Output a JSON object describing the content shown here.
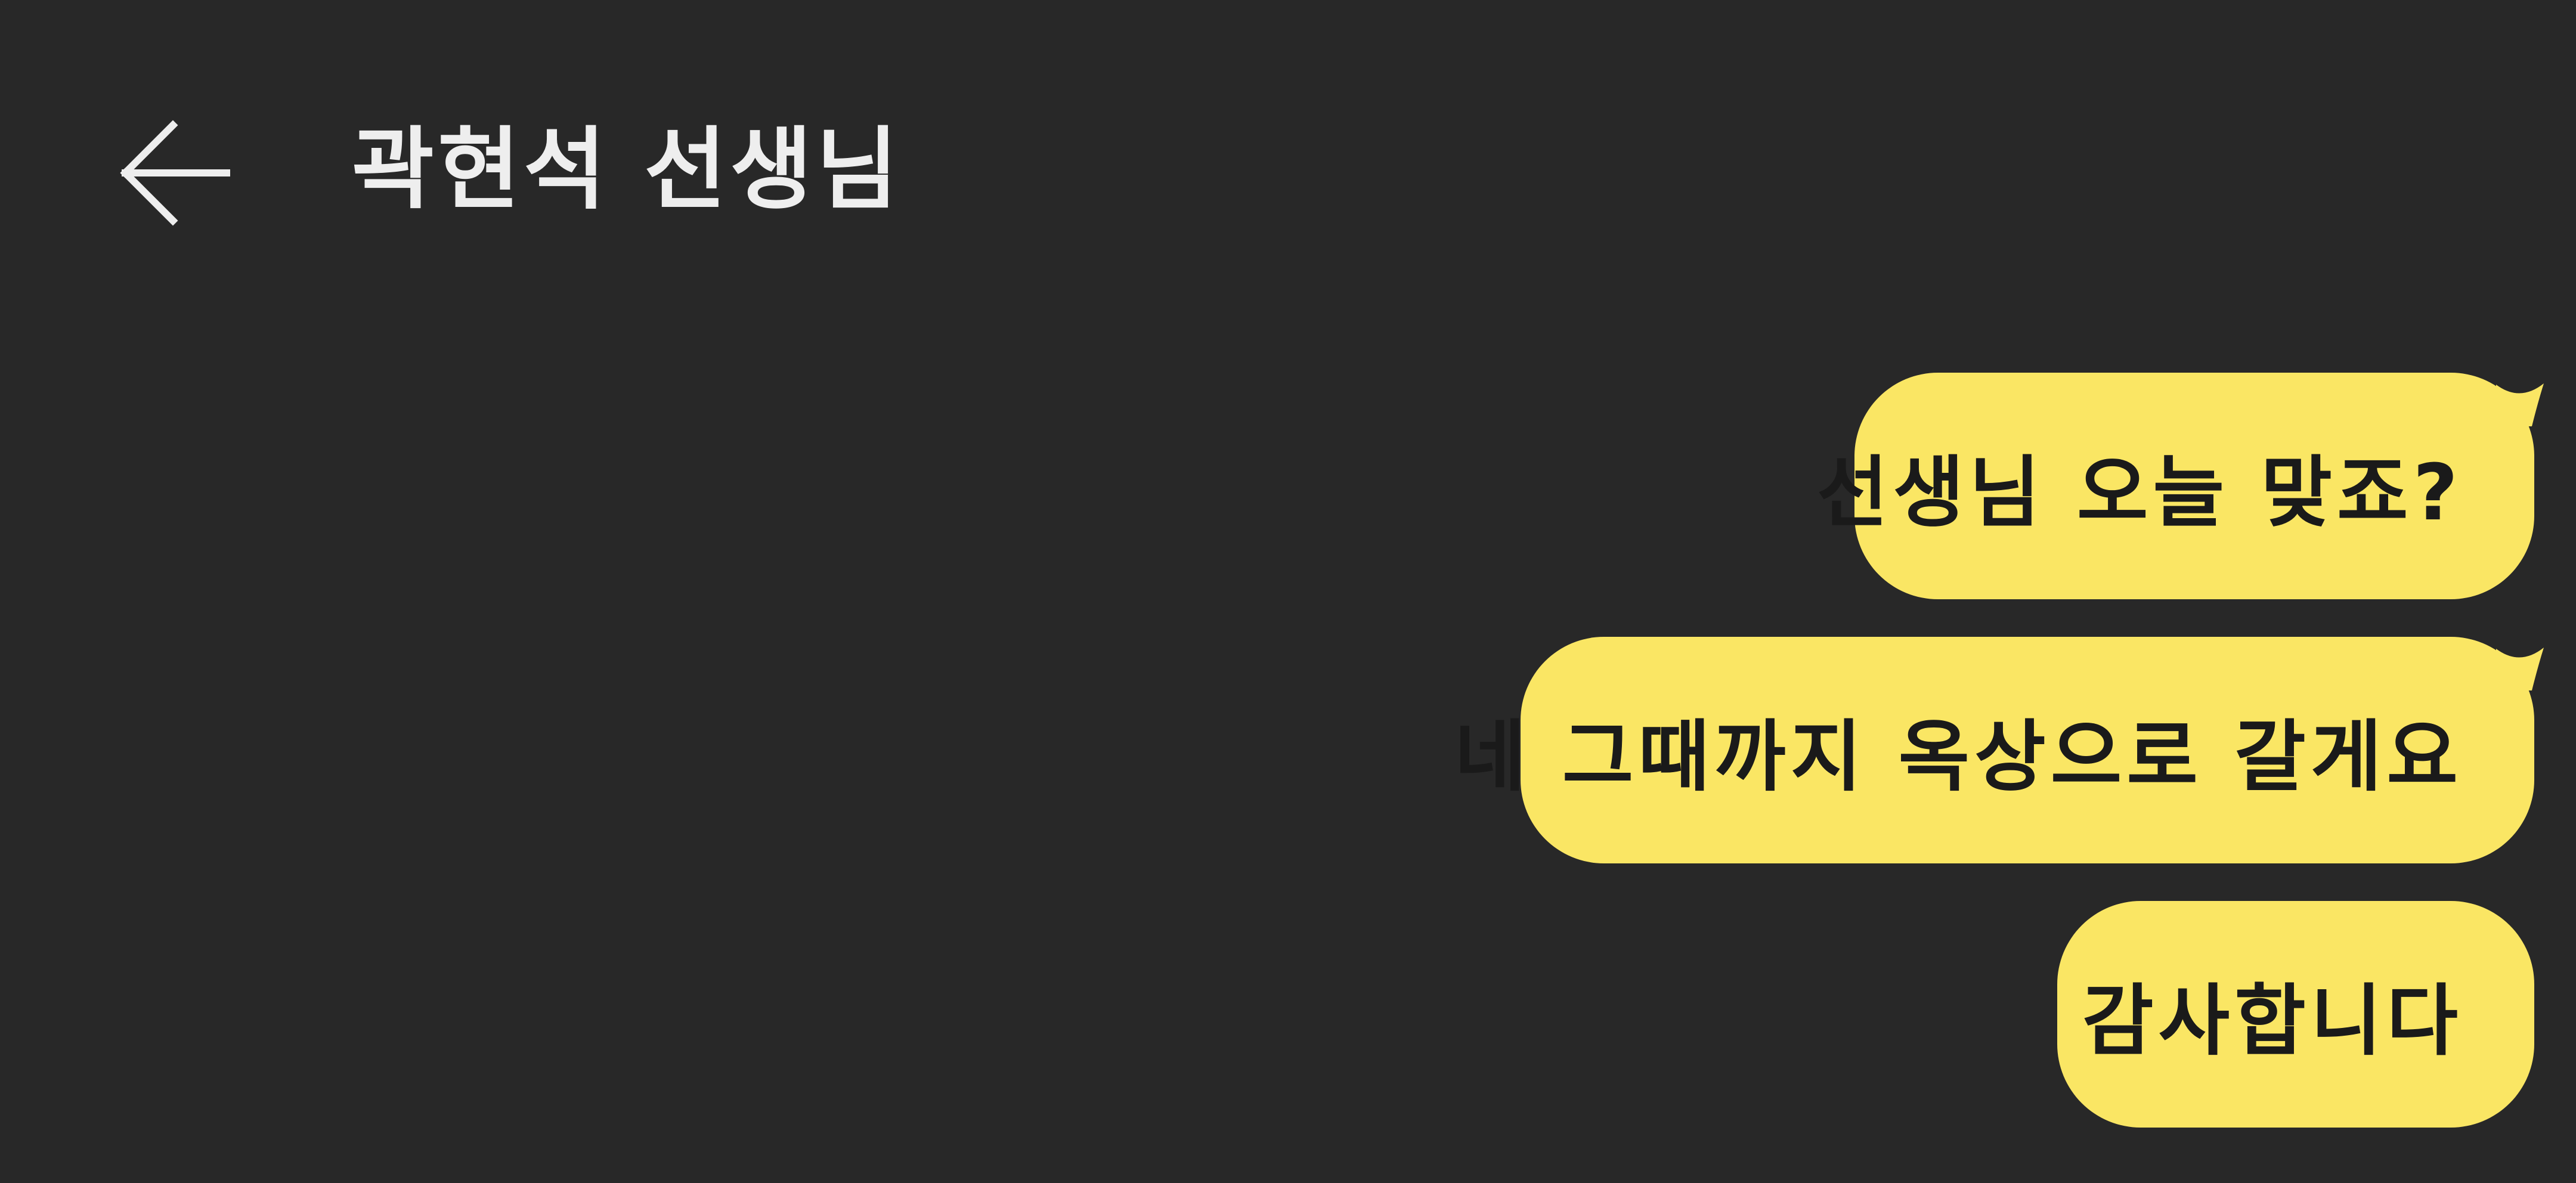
{
  "header": {
    "back_icon": "arrow-left-icon",
    "title": "곽현석 선생님"
  },
  "messages": [
    {
      "text": "선생님 오늘 맞죠?"
    },
    {
      "text": "네 그때까지 옥상으로 갈게요"
    },
    {
      "text": "감사합니다"
    }
  ],
  "colors": {
    "background": "#282828",
    "bubble": "#FAE664",
    "title_text": "#EEEEEE",
    "bubble_text": "#1A1A1A"
  }
}
